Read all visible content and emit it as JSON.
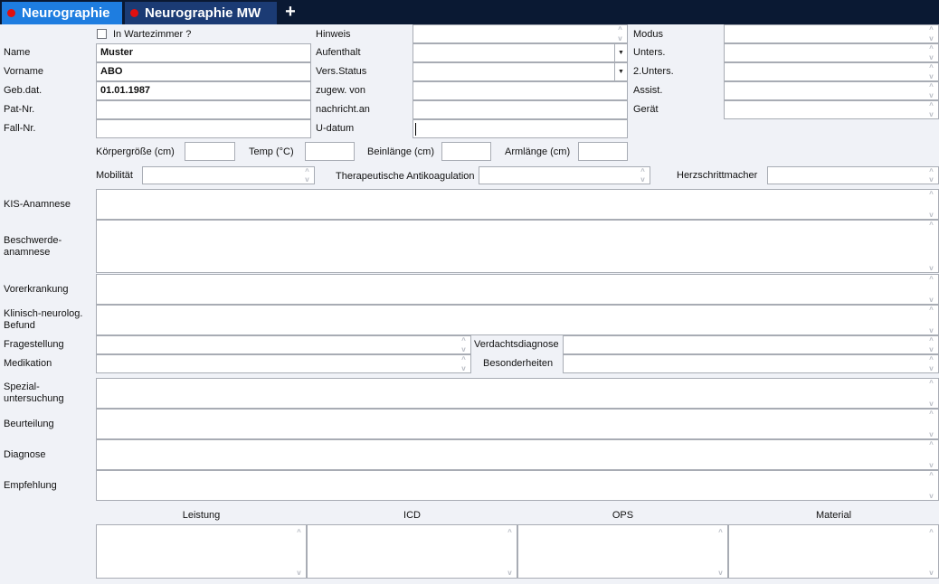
{
  "tabs": [
    {
      "label": "Neurographie"
    },
    {
      "label": "Neurographie MW"
    }
  ],
  "add_tab_label": "+",
  "icons": {
    "add_tab": "plus-icon",
    "spin_up": "chevron-up-icon",
    "spin_down": "chevron-down-icon",
    "dropdown": "dropdown-arrow-icon"
  },
  "spin_glyphs": {
    "up": "^",
    "down": "v",
    "dropdown": "▼"
  },
  "colors": {
    "active_tab": "#1e7de0",
    "inactive_tab": "#1b3b74",
    "tabbar": "#0a1933",
    "tab_dot": "#e01010",
    "background": "#f0f2f7"
  },
  "patient": {
    "waiting_room_label": "In Wartezimmer ?",
    "name_label": "Name",
    "name_value": "Muster",
    "vorname_label": "Vorname",
    "vorname_value": "ABO",
    "gebdat_label": "Geb.dat.",
    "gebdat_value": "01.01.1987",
    "patnr_label": "Pat-Nr.",
    "patnr_value": "",
    "fallnr_label": "Fall-Nr.",
    "fallnr_value": ""
  },
  "admin": {
    "hinweis_label": "Hinweis",
    "aufenthalt_label": "Aufenthalt",
    "versstatus_label": "Vers.Status",
    "zugew_label": "zugew. von",
    "nachricht_label": "nachricht.an",
    "udatum_label": "U-datum"
  },
  "exam": {
    "modus_label": "Modus",
    "unters_label": "Unters.",
    "unters2_label": "2.Unters.",
    "assist_label": "Assist.",
    "geraet_label": "Gerät"
  },
  "measures": {
    "koerper_label": "Körpergröße (cm)",
    "temp_label": "Temp (°C)",
    "bein_label": "Beinlänge (cm)",
    "arm_label": "Armlänge (cm)"
  },
  "flags": {
    "mobil_label": "Mobilität",
    "antikoag_label": "Therapeutische Antikoagulation",
    "herz_label": "Herzschrittmacher"
  },
  "sections": {
    "kis": "KIS-Anamnese",
    "beschwerde": "Beschwerde-\nanamnese",
    "vorerkrankung": "Vorerkrankung",
    "klinisch": "Klinisch-neurolog.\nBefund",
    "frage": "Fragestellung",
    "verdacht": "Verdachtsdiagnose",
    "medikation": "Medikation",
    "besonder": "Besonderheiten",
    "spezial": "Spezial-\nuntersuchung",
    "beurteilung": "Beurteilung",
    "diagnose": "Diagnose",
    "empfehlung": "Empfehlung"
  },
  "billing": {
    "leistung": "Leistung",
    "icd": "ICD",
    "ops": "OPS",
    "material": "Material"
  }
}
